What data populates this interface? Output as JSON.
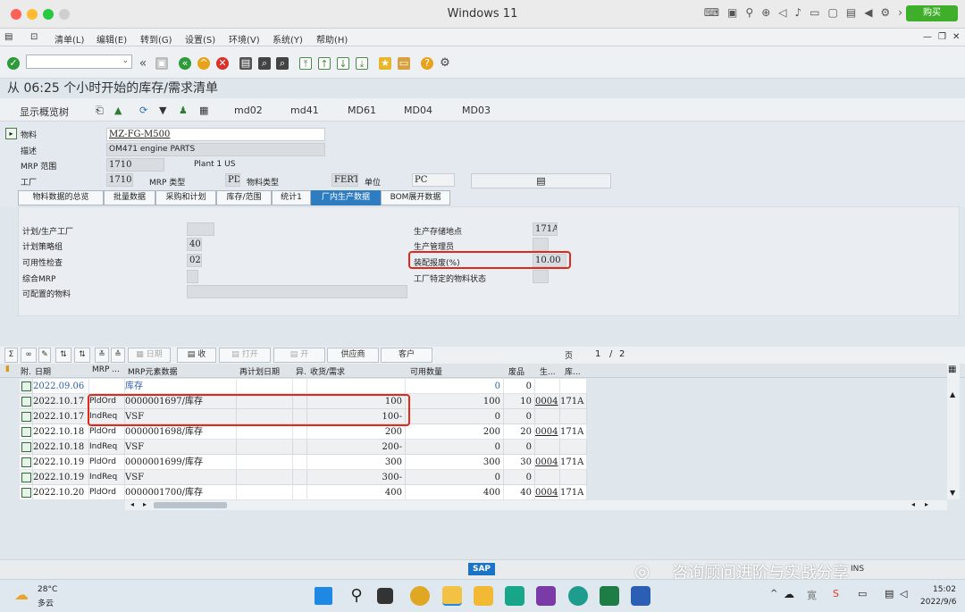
{
  "window": {
    "title": "Windows 11",
    "buy_button": "购买"
  },
  "menu": [
    "清单(L)",
    "编辑(E)",
    "转到(G)",
    "设置(S)",
    "环境(V)",
    "系统(Y)",
    "帮助(H)"
  ],
  "page_title": "从 06:25 个小时开始的库存/需求清单",
  "app_toolbar": {
    "show_tree": "显示概览树",
    "buttons": [
      "md02",
      "md41",
      "MD61",
      "MD04",
      "MD03"
    ]
  },
  "header": {
    "material_label": "物料",
    "material_value": "MZ-FG-M500",
    "desc_label": "描述",
    "desc_value": "OM471 engine PARTS",
    "mrp_area_label": "MRP 范围",
    "mrp_area_value": "1710",
    "mrp_area_text": "Plant 1 US",
    "plant_label": "工厂",
    "plant_value": "1710",
    "mrp_type_label": "MRP 类型",
    "mrp_type_value": "PD",
    "mat_type_label": "物料类型",
    "mat_type_value": "FERT",
    "unit_label": "单位",
    "unit_value": "PC"
  },
  "tabs": [
    "物料数据的总览",
    "批量数据",
    "采购和计划",
    "库存/范围",
    "统计1",
    "厂内生产数据",
    "BOM展开数据"
  ],
  "active_tab_index": 5,
  "panel": {
    "left": [
      {
        "label": "计划/生产工厂",
        "value": ""
      },
      {
        "label": "计划策略组",
        "value": "40"
      },
      {
        "label": "可用性检查",
        "value": "02"
      },
      {
        "label": "综合MRP",
        "value": ""
      },
      {
        "label": "可配置的物料",
        "value": ""
      }
    ],
    "right": [
      {
        "label": "生产存储地点",
        "value": "171A"
      },
      {
        "label": "生产管理员",
        "value": ""
      },
      {
        "label": "装配报废(%)",
        "value": "10.00"
      },
      {
        "label": "工厂特定的物料状态",
        "value": ""
      }
    ]
  },
  "grid_toolbar": {
    "date": "日期",
    "receive": "收",
    "open1": "打开",
    "open2": "开",
    "vendor": "供应商",
    "customer": "客户",
    "page_label": "页",
    "page_current": "1",
    "page_total": "2"
  },
  "grid_headers": [
    "附.",
    "日期",
    "MRP ...",
    "MRP元素数据",
    "再计划日期",
    "异.",
    "收货/需求",
    "可用数量",
    "废品",
    "生...",
    "库..."
  ],
  "rows": [
    {
      "date": "2022.09.06",
      "mrp": "",
      "element": "库存",
      "qty": "",
      "avail": "0",
      "scrap": "0",
      "prod": "",
      "loc": "",
      "blue": true
    },
    {
      "date": "2022.10.17",
      "mrp": "PldOrd",
      "element": "0000001697/库存",
      "qty": "100",
      "avail": "100",
      "scrap": "10",
      "prod": "0004",
      "loc": "171A"
    },
    {
      "date": "2022.10.17",
      "mrp": "IndReq",
      "element": "VSF",
      "qty": "100-",
      "avail": "0",
      "scrap": "0",
      "prod": "",
      "loc": ""
    },
    {
      "date": "2022.10.18",
      "mrp": "PldOrd",
      "element": "0000001698/库存",
      "qty": "200",
      "avail": "200",
      "scrap": "20",
      "prod": "0004",
      "loc": "171A"
    },
    {
      "date": "2022.10.18",
      "mrp": "IndReq",
      "element": "VSF",
      "qty": "200-",
      "avail": "0",
      "scrap": "0",
      "prod": "",
      "loc": ""
    },
    {
      "date": "2022.10.19",
      "mrp": "PldOrd",
      "element": "0000001699/库存",
      "qty": "300",
      "avail": "300",
      "scrap": "30",
      "prod": "0004",
      "loc": "171A"
    },
    {
      "date": "2022.10.19",
      "mrp": "IndReq",
      "element": "VSF",
      "qty": "300-",
      "avail": "0",
      "scrap": "0",
      "prod": "",
      "loc": ""
    },
    {
      "date": "2022.10.20",
      "mrp": "PldOrd",
      "element": "0000001700/库存",
      "qty": "400",
      "avail": "400",
      "scrap": "40",
      "prod": "0004",
      "loc": "171A"
    }
  ],
  "status": {
    "sap": "SAP",
    "watermark": "咨询顾问进阶与实战分享",
    "mode": "INS"
  },
  "taskbar": {
    "temp": "28°C",
    "weather": "多云",
    "time": "15:02",
    "date": "2022/9/6"
  }
}
